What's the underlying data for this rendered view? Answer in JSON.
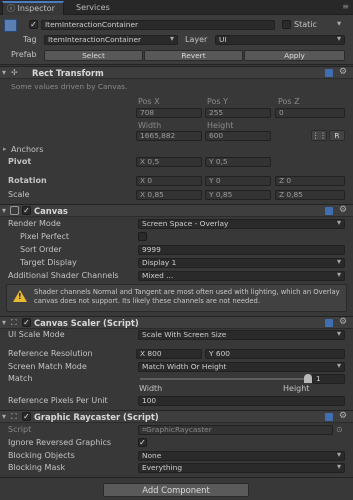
{
  "tabs": [
    {
      "label": "Inspector"
    },
    {
      "label": "Services"
    }
  ],
  "gameobject": {
    "name": "ItemInteractionContainer",
    "static_label": "Static",
    "tag_label": "Tag",
    "tag_value": "ItemInteractionContainer",
    "layer_label": "Layer",
    "layer_value": "UI",
    "prefab_label": "Prefab",
    "prefab_buttons": [
      "Select",
      "Revert",
      "Apply"
    ]
  },
  "rect_transform": {
    "title": "Rect Transform",
    "note": "Some values driven by Canvas.",
    "pos_x_label": "Pos X",
    "pos_y_label": "Pos Y",
    "pos_z_label": "Pos Z",
    "pos_x": "708",
    "pos_y": "255",
    "pos_z": "0",
    "width_label": "Width",
    "height_label": "Height",
    "width": "1665,882",
    "height": "600",
    "r_button": "R",
    "anchors_label": "Anchors",
    "pivot_label": "Pivot",
    "pivot_x": "X 0,5",
    "pivot_y": "Y 0,5",
    "rotation_label": "Rotation",
    "rot_x": "X  0",
    "rot_y": "Y  0",
    "rot_z": "Z  0",
    "scale_label": "Scale",
    "scale_x": "X  0,85",
    "scale_y": "Y  0,85",
    "scale_z": "Z  0,85"
  },
  "canvas": {
    "title": "Canvas",
    "render_mode_label": "Render Mode",
    "render_mode": "Screen Space - Overlay",
    "pixel_perfect_label": "Pixel Perfect",
    "sort_order_label": "Sort Order",
    "sort_order": "9999",
    "target_display_label": "Target Display",
    "target_display": "Display 1",
    "shader_channels_label": "Additional Shader Channels",
    "shader_channels": "Mixed ...",
    "warning": "Shader channels Normal and Tangent are most often used with lighting, which an Overlay canvas does not support. Its likely these channels are not needed."
  },
  "canvas_scaler": {
    "title": "Canvas Scaler (Script)",
    "ui_scale_mode_label": "UI Scale Mode",
    "ui_scale_mode": "Scale With Screen Size",
    "ref_res_label": "Reference Resolution",
    "ref_x": "X  800",
    "ref_y": "Y  600",
    "screen_match_label": "Screen Match Mode",
    "screen_match": "Match Width Or Height",
    "match_label": "Match",
    "match_value": "1",
    "match_fraction": 1,
    "width_word": "Width",
    "height_word": "Height",
    "ref_ppu_label": "Reference Pixels Per Unit",
    "ref_ppu": "100"
  },
  "raycaster": {
    "title": "Graphic Raycaster (Script)",
    "script_label": "Script",
    "script_value": "GraphicRaycaster",
    "ignore_reversed_label": "Ignore Reversed Graphics",
    "blocking_objects_label": "Blocking Objects",
    "blocking_objects": "None",
    "blocking_mask_label": "Blocking Mask",
    "blocking_mask": "Everything"
  },
  "add_component": "Add Component",
  "colors": {
    "accent": "#3f6fb0",
    "panel": "#383838",
    "field": "#2a2a2a"
  }
}
